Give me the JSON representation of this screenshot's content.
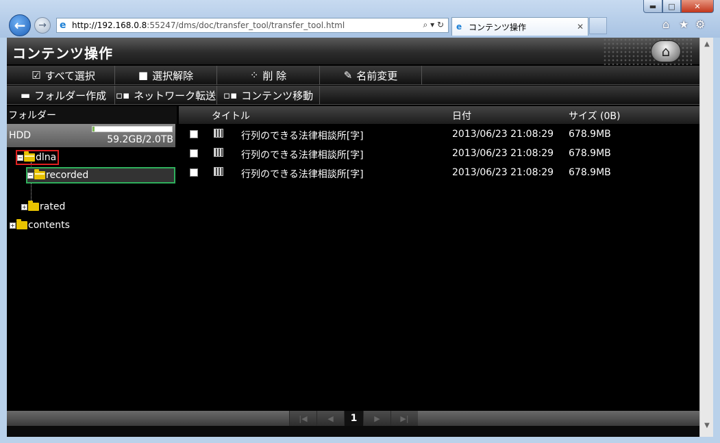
{
  "browser": {
    "url_host": "http://192.168.0.8",
    "url_path": ":55247/dms/doc/transfer_tool/transfer_tool.html",
    "tab_title": "コンテンツ操作",
    "window_buttons": {
      "minimize": "▬",
      "maximize": "□",
      "close": "✕"
    }
  },
  "page": {
    "title": "コンテンツ操作"
  },
  "toolbar1": [
    {
      "label": "すべて選択",
      "icon": "☑"
    },
    {
      "label": "選択解除",
      "icon": "■"
    },
    {
      "label": "削 除",
      "icon": "⁘"
    },
    {
      "label": "名前変更",
      "icon": "✎"
    }
  ],
  "toolbar2": [
    {
      "label": "フォルダー作成",
      "icon": "▬"
    },
    {
      "label": "ネットワーク転送",
      "icon": "▫▪"
    },
    {
      "label": "コンテンツ移動",
      "icon": "▫▪"
    }
  ],
  "folders": {
    "header": "フォルダー",
    "hdd_label": "HDD",
    "hdd_size": "59.2GB/2.0TB",
    "hdd_used_fraction": 0.03,
    "tree": {
      "dlna": "dlna",
      "recorded": "recorded",
      "rated": "rated",
      "contents": "contents"
    }
  },
  "files": {
    "columns": {
      "title": "タイトル",
      "date": "日付",
      "size": "サイズ (0B)"
    },
    "rows": [
      {
        "title": "行列のできる法律相談所[字]",
        "date": "2013/06/23 21:08:29",
        "size": "678.9MB"
      },
      {
        "title": "行列のできる法律相談所[字]",
        "date": "2013/06/23 21:08:29",
        "size": "678.9MB"
      },
      {
        "title": "行列のできる法律相談所[字]",
        "date": "2013/06/23 21:08:29",
        "size": "678.9MB"
      }
    ]
  },
  "pager": {
    "current_page": "1",
    "first": "|◀",
    "prev": "◀",
    "next": "▶",
    "last": "▶|"
  }
}
